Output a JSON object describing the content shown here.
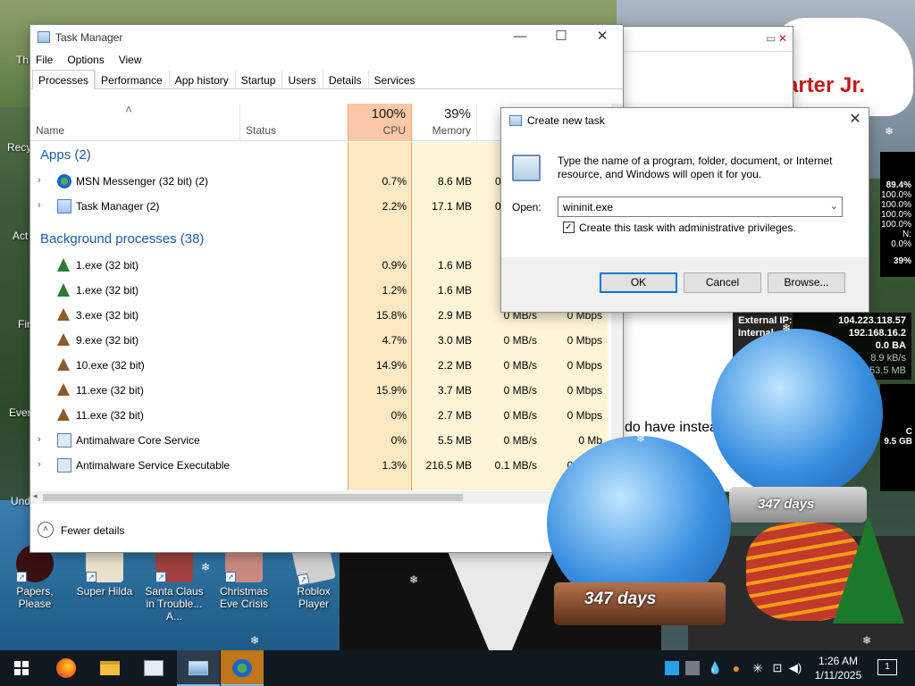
{
  "desktop": {
    "edge_labels": [
      "Th",
      "Recy",
      "Act",
      "Fir",
      "Ever",
      "Und"
    ],
    "icons": [
      {
        "label": "Papers, Please",
        "color": "#3a1010"
      },
      {
        "label": "Super Hilda",
        "color": "#e8e0c8"
      },
      {
        "label": "Santa Claus in Trouble... A...",
        "color": "#a04040"
      },
      {
        "label": "Christmas Eve Crisis",
        "color": "#c88a80"
      },
      {
        "label": "Roblox Player",
        "color": "#d0d0d0"
      }
    ],
    "speech_text": "arter Jr.",
    "speech_letter": "e"
  },
  "browser": {
    "text": "do have instea",
    "link": "w!"
  },
  "task_manager": {
    "title": "Task Manager",
    "menu": [
      "File",
      "Options",
      "View"
    ],
    "tabs": [
      "Processes",
      "Performance",
      "App history",
      "Startup",
      "Users",
      "Details",
      "Services"
    ],
    "headers": {
      "name": "Name",
      "status": "Status",
      "cpu_pct": "100%",
      "cpu": "CPU",
      "mem_pct": "39%",
      "mem": "Memory"
    },
    "groups": {
      "apps": "Apps (2)",
      "background": "Background processes (38)"
    },
    "apps": [
      {
        "name": "MSN Messenger (32 bit) (2)",
        "cpu": "0.7%",
        "mem": "8.6 MB",
        "disk": "0",
        "icon": "msn-icon"
      },
      {
        "name": "Task Manager (2)",
        "cpu": "2.2%",
        "mem": "17.1 MB",
        "disk": "0",
        "icon": "task-manager-icon"
      }
    ],
    "background": [
      {
        "name": "1.exe (32 bit)",
        "cpu": "0.9%",
        "mem": "1.6 MB",
        "disk": "",
        "net": "",
        "icon": "tree-icon"
      },
      {
        "name": "1.exe (32 bit)",
        "cpu": "1.2%",
        "mem": "1.6 MB",
        "disk": "",
        "net": "",
        "icon": "tree-icon"
      },
      {
        "name": "3.exe (32 bit)",
        "cpu": "15.8%",
        "mem": "2.9 MB",
        "disk": "0 MB/s",
        "net": "0 Mbps",
        "icon": "poop-icon"
      },
      {
        "name": "9.exe (32 bit)",
        "cpu": "4.7%",
        "mem": "3.0 MB",
        "disk": "0 MB/s",
        "net": "0 Mbps",
        "icon": "poop-icon"
      },
      {
        "name": "10.exe (32 bit)",
        "cpu": "14.9%",
        "mem": "2.2 MB",
        "disk": "0 MB/s",
        "net": "0 Mbps",
        "icon": "poop-icon"
      },
      {
        "name": "11.exe (32 bit)",
        "cpu": "15.9%",
        "mem": "3.7 MB",
        "disk": "0 MB/s",
        "net": "0 Mbps",
        "icon": "poop-icon"
      },
      {
        "name": "11.exe (32 bit)",
        "cpu": "0%",
        "mem": "2.7 MB",
        "disk": "0 MB/s",
        "net": "0 Mbps",
        "icon": "poop-icon"
      },
      {
        "name": "Antimalware Core Service",
        "cpu": "0%",
        "mem": "5.5 MB",
        "disk": "0 MB/s",
        "net": "0 Mb",
        "icon": "service-icon"
      },
      {
        "name": "Antimalware Service Executable",
        "cpu": "1.3%",
        "mem": "216.5 MB",
        "disk": "0.1 MB/s",
        "net": "0 Mbps",
        "icon": "service-icon"
      }
    ],
    "footer": "Fewer details"
  },
  "dialog": {
    "title": "Create new task",
    "description": "Type the name of a program, folder, document, or Internet resource, and Windows will open it for you.",
    "open_label": "Open:",
    "open_value": "wininit.exe",
    "checkbox_label": "Create this task with administrative privileges.",
    "checkbox_checked": true,
    "ok": "OK",
    "cancel": "Cancel",
    "browse": "Browse..."
  },
  "sysmon": {
    "values": [
      "89.4%",
      "100.0%",
      "100.0%",
      "100.0%",
      "100.0%"
    ],
    "partial": "N: 0.0%",
    "cpu": "39%"
  },
  "netmon": {
    "external_label": "External IP:",
    "external_ip": "104.223.118.57",
    "internal_label": "Internal",
    "internal_ip": "192.168.16.2",
    "rate1": "0.0 BA",
    "rate2": "8.9 kB/s",
    "rate3": "53.5 MB"
  },
  "gmon": {
    "temp": "C",
    "size": "9.5 GB"
  },
  "globes": {
    "count_left": "347 days",
    "count_right": "347 days"
  },
  "taskbar": {
    "time": "1:26 AM",
    "date": "1/11/2025",
    "notifications": "1",
    "apps": [
      "start",
      "firefox",
      "file-explorer",
      "ms-paint",
      "task-manager",
      "msn-messenger"
    ]
  }
}
